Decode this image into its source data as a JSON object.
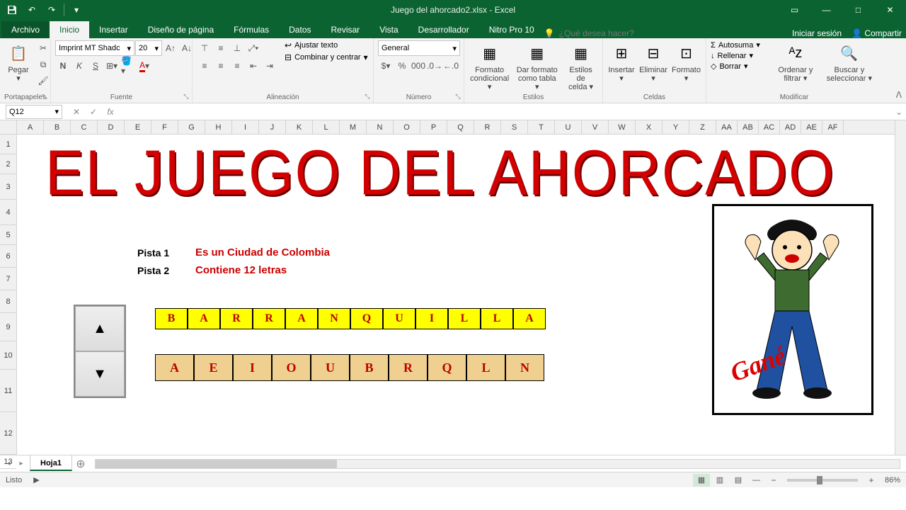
{
  "app": {
    "title": "Juego del ahorcado2.xlsx - Excel"
  },
  "tabs": {
    "file": "Archivo",
    "home": "Inicio",
    "insert": "Insertar",
    "layout": "Diseño de página",
    "formulas": "Fórmulas",
    "data": "Datos",
    "review": "Revisar",
    "view": "Vista",
    "developer": "Desarrollador",
    "nitro": "Nitro Pro 10",
    "tellme": "¿Qué desea hacer?",
    "signin": "Iniciar sesión",
    "share": "Compartir"
  },
  "ribbon": {
    "clipboard": {
      "paste": "Pegar",
      "label": "Portapapeles"
    },
    "font": {
      "name": "Imprint MT Shadc",
      "size": "20",
      "label": "Fuente"
    },
    "align": {
      "wrap": "Ajustar texto",
      "merge": "Combinar y centrar",
      "label": "Alineación"
    },
    "number": {
      "format": "General",
      "label": "Número"
    },
    "styles": {
      "cond": "Formato condicional",
      "table": "Dar formato como tabla",
      "cell": "Estilos de celda",
      "label": "Estilos"
    },
    "cells": {
      "insert": "Insertar",
      "delete": "Eliminar",
      "format": "Formato",
      "label": "Celdas"
    },
    "editing": {
      "sum": "Autosuma",
      "fill": "Rellenar",
      "clear": "Borrar",
      "sort": "Ordenar y filtrar",
      "find": "Buscar y seleccionar",
      "label": "Modificar"
    }
  },
  "formula": {
    "ref": "Q12",
    "value": ""
  },
  "columns": [
    "A",
    "B",
    "C",
    "D",
    "E",
    "F",
    "G",
    "H",
    "I",
    "J",
    "K",
    "L",
    "M",
    "N",
    "O",
    "P",
    "Q",
    "R",
    "S",
    "T",
    "U",
    "V",
    "W",
    "X",
    "Y",
    "Z",
    "AA",
    "AB",
    "AC",
    "AD",
    "AE",
    "AF"
  ],
  "rows": [
    "1",
    "2",
    "3",
    "4",
    "5",
    "6",
    "7",
    "8",
    "9",
    "10",
    "11",
    "12",
    "13"
  ],
  "game": {
    "title": "EL JUEGO DEL AHORCADO",
    "hint1_label": "Pista 1",
    "hint1": "Es un Ciudad de Colombia",
    "hint2_label": "Pista 2",
    "hint2": "Contiene 12 letras",
    "answer": [
      "B",
      "A",
      "R",
      "R",
      "A",
      "N",
      "Q",
      "U",
      "I",
      "L",
      "L",
      "A"
    ],
    "input": [
      "A",
      "E",
      "I",
      "O",
      "U",
      "B",
      "R",
      "Q",
      "L",
      "N"
    ],
    "win": "Gané"
  },
  "sheet": {
    "name": "Hoja1"
  },
  "status": {
    "ready": "Listo",
    "zoom": "86%"
  }
}
